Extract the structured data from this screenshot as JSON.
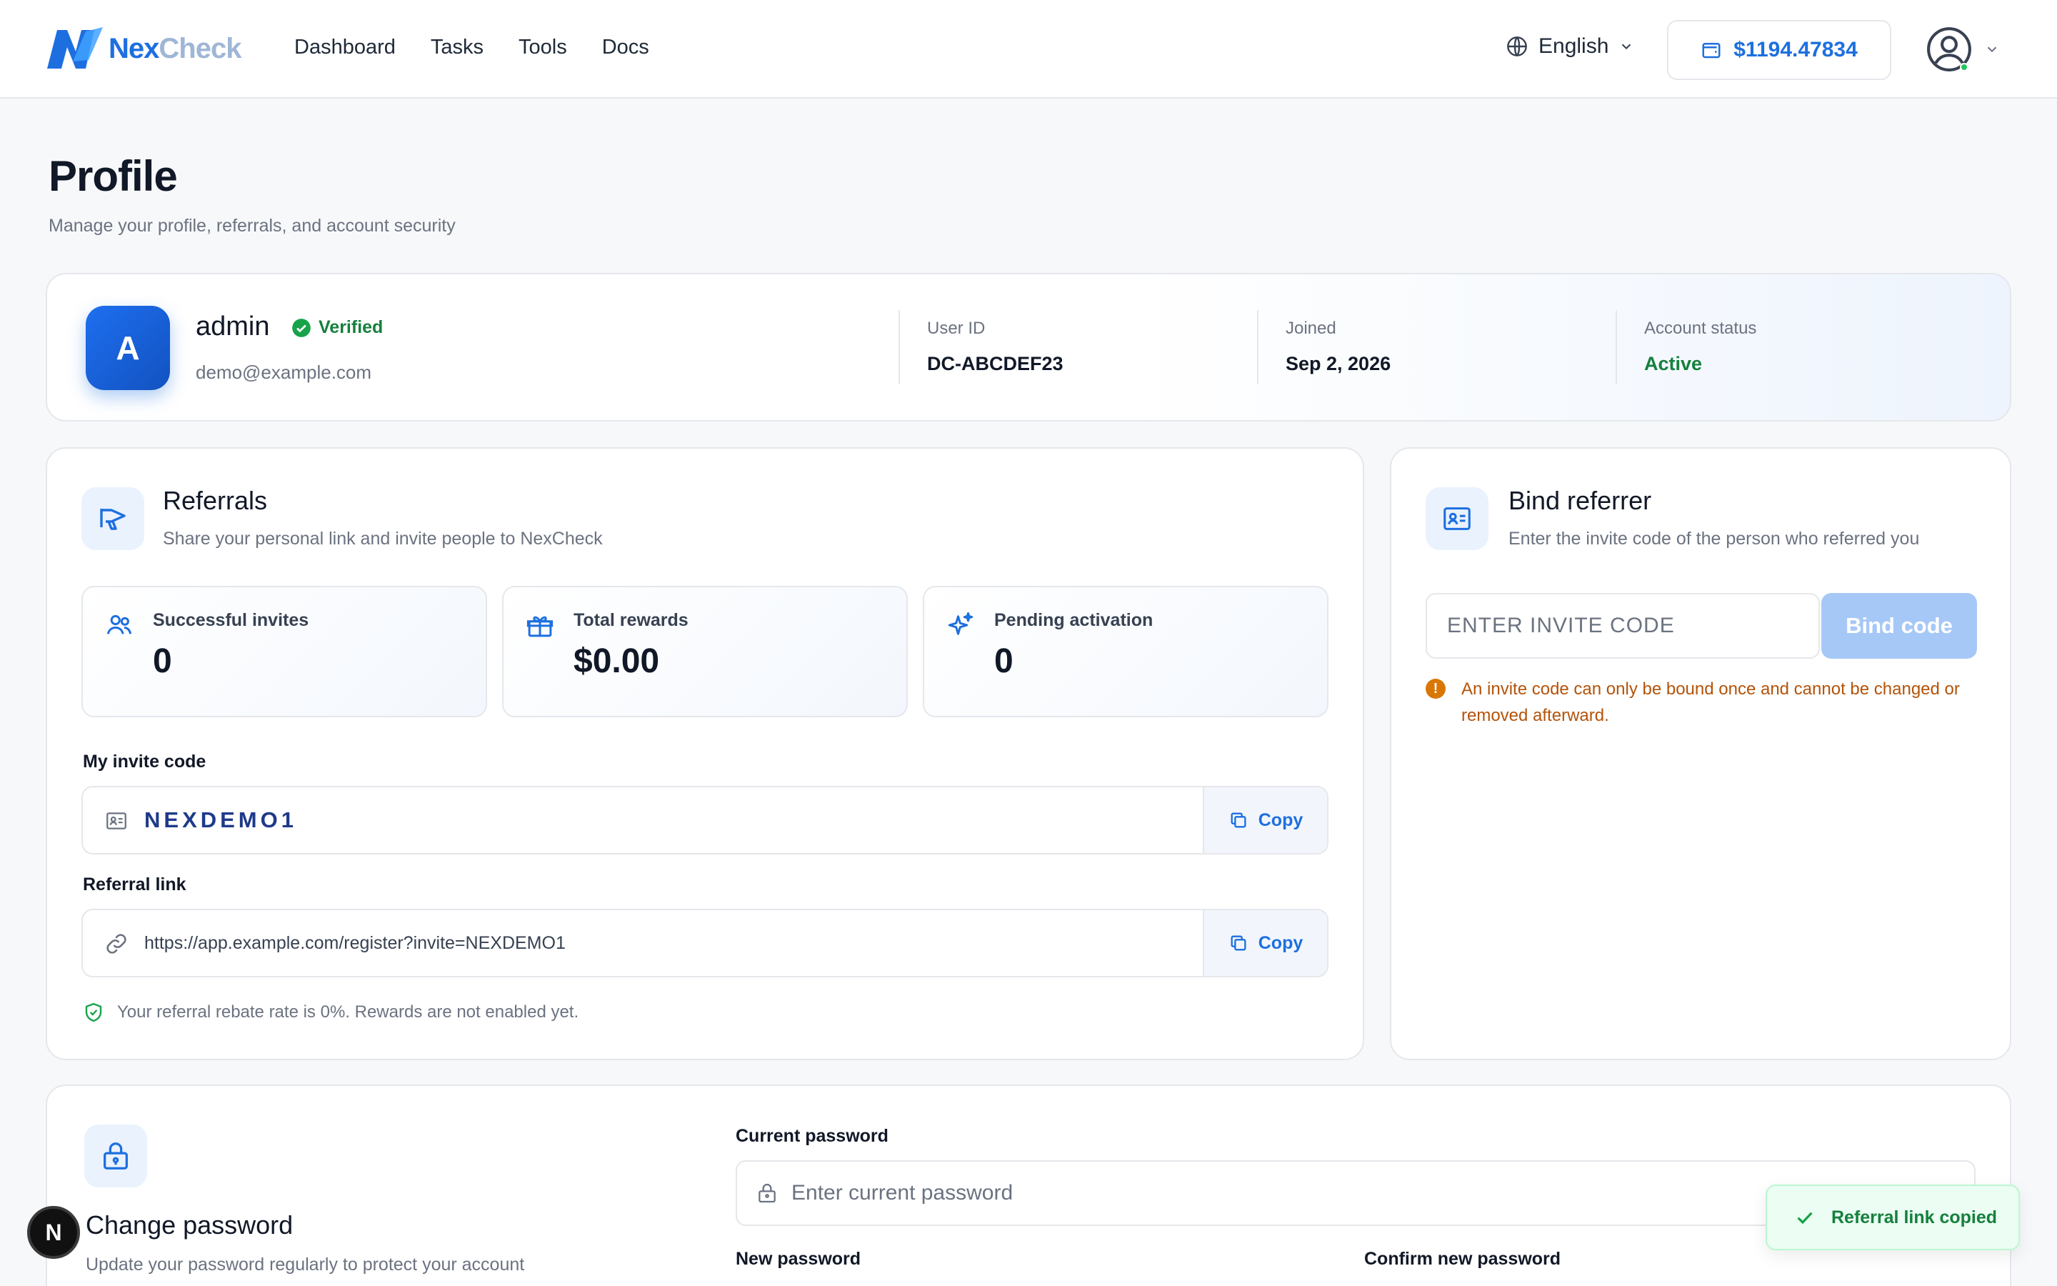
{
  "app": {
    "logo_nex": "Nex",
    "logo_check": "Check",
    "nav": [
      "Dashboard",
      "Tasks",
      "Tools",
      "Docs"
    ],
    "language": "English",
    "balance": "$1194.47834"
  },
  "page": {
    "title": "Profile",
    "subtitle": "Manage your profile, referrals, and account security"
  },
  "profile": {
    "avatar_letter": "A",
    "username": "admin",
    "verified_label": "Verified",
    "email": "demo@example.com",
    "user_id_label": "User ID",
    "user_id": "DC-ABCDEF23",
    "joined_label": "Joined",
    "joined": "Sep 2, 2026",
    "status_label": "Account status",
    "status": "Active"
  },
  "referrals": {
    "title": "Referrals",
    "subtitle": "Share your personal link and invite people to NexCheck",
    "stats": [
      {
        "label": "Successful invites",
        "value": "0",
        "icon": "users-icon"
      },
      {
        "label": "Total rewards",
        "value": "$0.00",
        "icon": "gift-icon"
      },
      {
        "label": "Pending activation",
        "value": "0",
        "icon": "sparkles-icon"
      }
    ],
    "invite_code_label": "My invite code",
    "invite_code": "NEXDEMO1",
    "referral_link_label": "Referral link",
    "referral_link": "https://app.example.com/register?invite=NEXDEMO1",
    "copy_label": "Copy",
    "rebate_note": "Your referral rebate rate is 0%. Rewards are not enabled yet."
  },
  "bind": {
    "title": "Bind referrer",
    "subtitle": "Enter the invite code of the person who referred you",
    "placeholder": "ENTER INVITE CODE",
    "button": "Bind code",
    "warning": "An invite code can only be bound once and cannot be changed or removed afterward."
  },
  "password": {
    "title": "Change password",
    "subtitle": "Update your password regularly to protect your account",
    "current_label": "Current password",
    "current_placeholder": "Enter current password",
    "new_label": "New password",
    "confirm_label": "Confirm new password"
  },
  "toast": {
    "message": "Referral link copied"
  },
  "dev_badge": "N",
  "colors": {
    "accent": "#1d6fe0",
    "success": "#15803d",
    "warning": "#b45309"
  }
}
